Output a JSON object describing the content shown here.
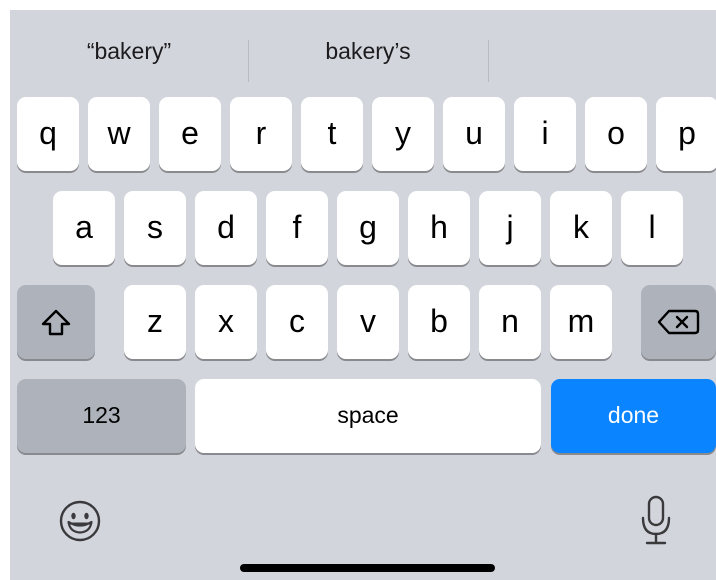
{
  "suggestions": [
    {
      "label": "“bakery”"
    },
    {
      "label": "bakery’s"
    },
    {
      "label": ""
    }
  ],
  "rows": {
    "row1": [
      "q",
      "w",
      "e",
      "r",
      "t",
      "y",
      "u",
      "i",
      "o",
      "p"
    ],
    "row2": [
      "a",
      "s",
      "d",
      "f",
      "g",
      "h",
      "j",
      "k",
      "l"
    ],
    "row3": [
      "z",
      "x",
      "c",
      "v",
      "b",
      "n",
      "m"
    ]
  },
  "keys": {
    "shift_icon": "shift-arrow-icon",
    "delete_icon": "backspace-icon",
    "numbers_label": "123",
    "space_label": "space",
    "done_label": "done"
  },
  "bottom_bar": {
    "emoji_icon": "emoji-smiley-icon",
    "dictation_icon": "microphone-icon"
  },
  "colors": {
    "keyboard_bg": "#d3d5dc",
    "key_bg": "#ffffff",
    "special_key_bg": "#adb2bb",
    "done_key_bg": "#0a84ff"
  }
}
